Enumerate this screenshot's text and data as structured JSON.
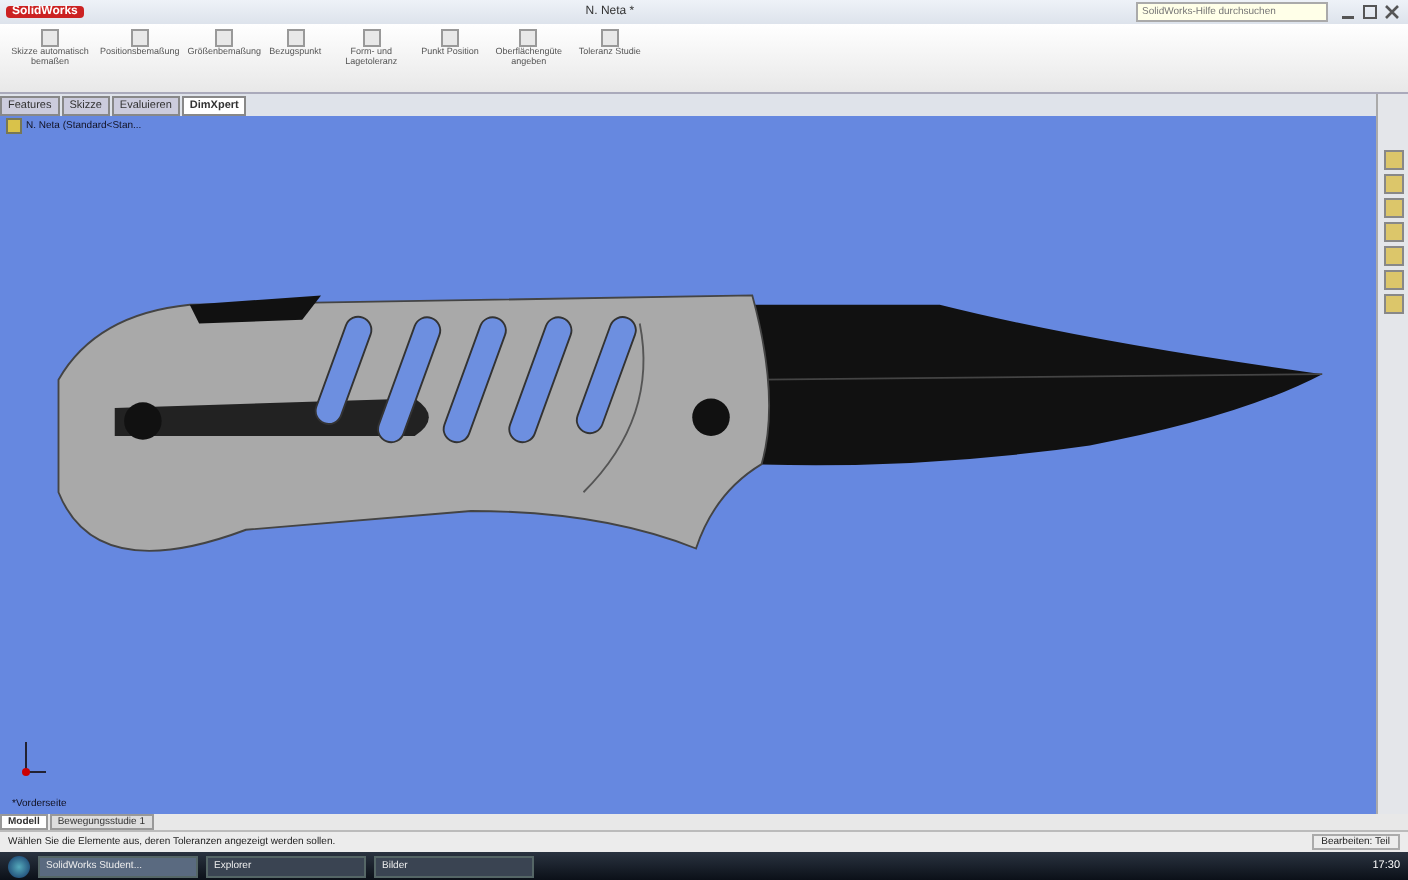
{
  "window": {
    "app": "SolidWorks",
    "title": "N. Neta *",
    "help_search": {
      "placeholder": "SolidWorks-Hilfe durchsuchen"
    }
  },
  "ribbon": [
    {
      "label": "Skizze automatisch bemaßen"
    },
    {
      "label": "Positionsbemaßung"
    },
    {
      "label": "Größenbemaßung"
    },
    {
      "label": "Bezugspunkt"
    },
    {
      "label": "Form- und Lagetoleranz"
    },
    {
      "label": "Punkt Position"
    },
    {
      "label": "Oberflächengüte angeben"
    },
    {
      "label": "Toleranz Studie"
    }
  ],
  "tabs": [
    {
      "label": "Features",
      "selected": false
    },
    {
      "label": "Skizze",
      "selected": false
    },
    {
      "label": "Evaluieren",
      "selected": false
    },
    {
      "label": "DimXpert",
      "selected": true
    }
  ],
  "tree": {
    "root": "N. Neta (Standard<Stan..."
  },
  "viewport": {
    "view_label": "*Vorderseite"
  },
  "bottom_tabs": [
    {
      "label": "Modell",
      "selected": true
    },
    {
      "label": "Bewegungsstudie 1",
      "selected": false
    }
  ],
  "status_bar": {
    "message": "Wählen Sie die Elemente aus, deren Toleranzen angezeigt werden sollen.",
    "mode": "Bearbeiten: Teil"
  },
  "taskbar": {
    "windows": [
      {
        "label": "SolidWorks Student...",
        "selected": true
      },
      {
        "label": "Explorer",
        "selected": false
      },
      {
        "label": "Bilder",
        "selected": false
      }
    ],
    "clock": "17:30"
  }
}
